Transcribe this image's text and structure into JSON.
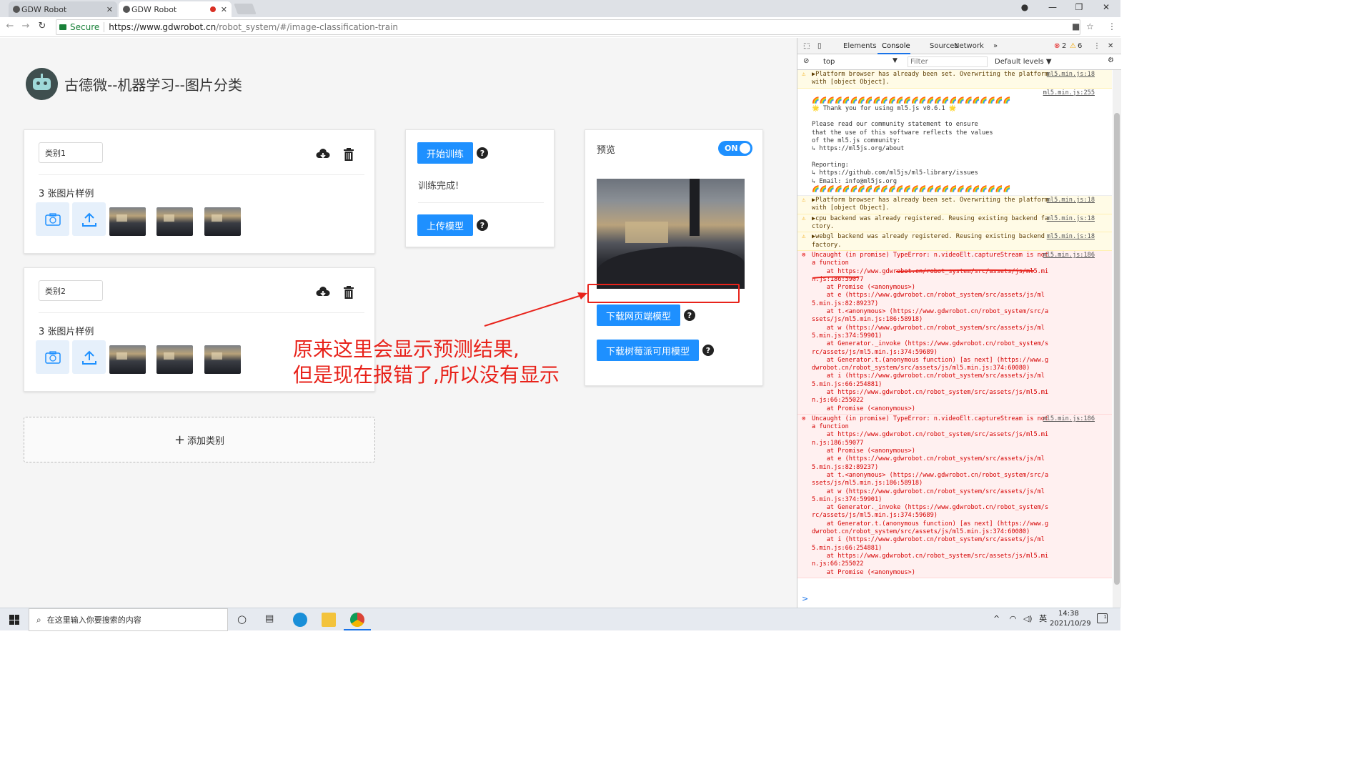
{
  "browser": {
    "tabs": [
      {
        "title": "GDW Robot",
        "active": false
      },
      {
        "title": "GDW Robot",
        "active": true
      }
    ],
    "address": {
      "secure_label": "Secure",
      "host": "https://www.gdwrobot.cn",
      "path": "/robot_system/#/image-classification-train"
    },
    "icons": {
      "back": "arrow-left-icon",
      "forward": "arrow-right-icon",
      "reload": "reload-icon",
      "lock": "lock-icon",
      "camera": "camera-icon",
      "bookmark": "star-icon",
      "menu": "kebab-menu-icon",
      "profile": "profile-icon"
    }
  },
  "app": {
    "title": "古德微--机器学习--图片分类"
  },
  "classes": [
    {
      "name": "类别1",
      "sample_count_label": "3 张图片样例"
    },
    {
      "name": "类别2",
      "sample_count_label": "3 张图片样例"
    }
  ],
  "add_class_label": "添加类别",
  "train": {
    "start_button": "开始训练",
    "status": "训练完成!",
    "upload_button": "上传模型",
    "help_glyph": "?"
  },
  "preview": {
    "title": "预览",
    "toggle_label": "ON",
    "download_web_button": "下载网页端模型",
    "download_pi_button": "下载树莓派可用模型"
  },
  "annotation": {
    "line1": "原来这里会显示预测结果,",
    "line2": "但是现在报错了,所以没有显示",
    "color": "#e8231b"
  },
  "devtools": {
    "tabs": [
      "Elements",
      "Console",
      "Sources",
      "Network"
    ],
    "more": "»",
    "error_count": "2",
    "warning_count": "6",
    "context": "top",
    "filter_placeholder": "Filter",
    "levels": "Default levels ▼",
    "prompt": ">",
    "messages": [
      {
        "level": "warn",
        "text": "▶Platform browser has already been set. Overwriting the platform with [object Object].",
        "source": "ml5.min.js:18"
      },
      {
        "level": "info",
        "text": "🌈🌈🌈🌈🌈🌈🌈🌈🌈🌈🌈🌈🌈🌈🌈🌈🌈🌈🌈🌈🌈🌈🌈🌈🌈🌈\n🌟 Thank you for using ml5.js v0.6.1 🌟\n\nPlease read our community statement to ensure\nthat the use of this software reflects the values\nof the ml5.js community:\n↳ https://ml5js.org/about\n\nReporting:\n↳ https://github.com/ml5js/ml5-library/issues\n↳ Email: info@ml5js.org\n🌈🌈🌈🌈🌈🌈🌈🌈🌈🌈🌈🌈🌈🌈🌈🌈🌈🌈🌈🌈🌈🌈🌈🌈🌈🌈",
        "source": "ml5.min.js:255"
      },
      {
        "level": "warn",
        "text": "▶Platform browser has already been set. Overwriting the platform with [object Object].",
        "source": "ml5.min.js:18"
      },
      {
        "level": "warn",
        "text": "▶cpu backend was already registered. Reusing existing backend factory.",
        "source": "ml5.min.js:18"
      },
      {
        "level": "warn",
        "text": "▶webgl backend was already registered. Reusing existing backend factory.",
        "source": "ml5.min.js:18"
      },
      {
        "level": "err",
        "text": "Uncaught (in promise) TypeError: n.videoElt.captureStream is not a function",
        "source": "ml5.min.js:186",
        "stack": [
          "    at https://www.gdwrobot.cn/robot_system/src/assets/js/ml5.min.js:186:59077",
          "    at Promise (<anonymous>)",
          "    at e (https://www.gdwrobot.cn/robot_system/src/assets/js/ml5.min.js:82:89237)",
          "    at t.<anonymous> (https://www.gdwrobot.cn/robot_system/src/assets/js/ml5.min.js:186:58918)",
          "    at w (https://www.gdwrobot.cn/robot_system/src/assets/js/ml5.min.js:374:59901)",
          "    at Generator._invoke (https://www.gdwrobot.cn/robot_system/src/assets/js/ml5.min.js:374:59689)",
          "    at Generator.t.(anonymous function) [as next] (https://www.gdwrobot.cn/robot_system/src/assets/js/ml5.min.js:374:60080)",
          "    at i (https://www.gdwrobot.cn/robot_system/src/assets/js/ml5.min.js:66:254881)",
          "    at https://www.gdwrobot.cn/robot_system/src/assets/js/ml5.min.js:66:255022",
          "    at Promise (<anonymous>)"
        ]
      },
      {
        "level": "err",
        "text": "Uncaught (in promise) TypeError: n.videoElt.captureStream is not a function",
        "source": "ml5.min.js:186",
        "stack": [
          "    at https://www.gdwrobot.cn/robot_system/src/assets/js/ml5.min.js:186:59077",
          "    at Promise (<anonymous>)",
          "    at e (https://www.gdwrobot.cn/robot_system/src/assets/js/ml5.min.js:82:89237)",
          "    at t.<anonymous> (https://www.gdwrobot.cn/robot_system/src/assets/js/ml5.min.js:186:58918)",
          "    at w (https://www.gdwrobot.cn/robot_system/src/assets/js/ml5.min.js:374:59901)",
          "    at Generator._invoke (https://www.gdwrobot.cn/robot_system/src/assets/js/ml5.min.js:374:59689)",
          "    at Generator.t.(anonymous function) [as next] (https://www.gdwrobot.cn/robot_system/src/assets/js/ml5.min.js:374:60080)",
          "    at i (https://www.gdwrobot.cn/robot_system/src/assets/js/ml5.min.js:66:254881)",
          "    at https://www.gdwrobot.cn/robot_system/src/assets/js/ml5.min.js:66:255022",
          "    at Promise (<anonymous>)"
        ]
      }
    ]
  },
  "taskbar": {
    "search_placeholder": "在这里输入你要搜索的内容",
    "ime": "英",
    "time": "14:38",
    "date": "2021/10/29",
    "notification_count": "1"
  }
}
